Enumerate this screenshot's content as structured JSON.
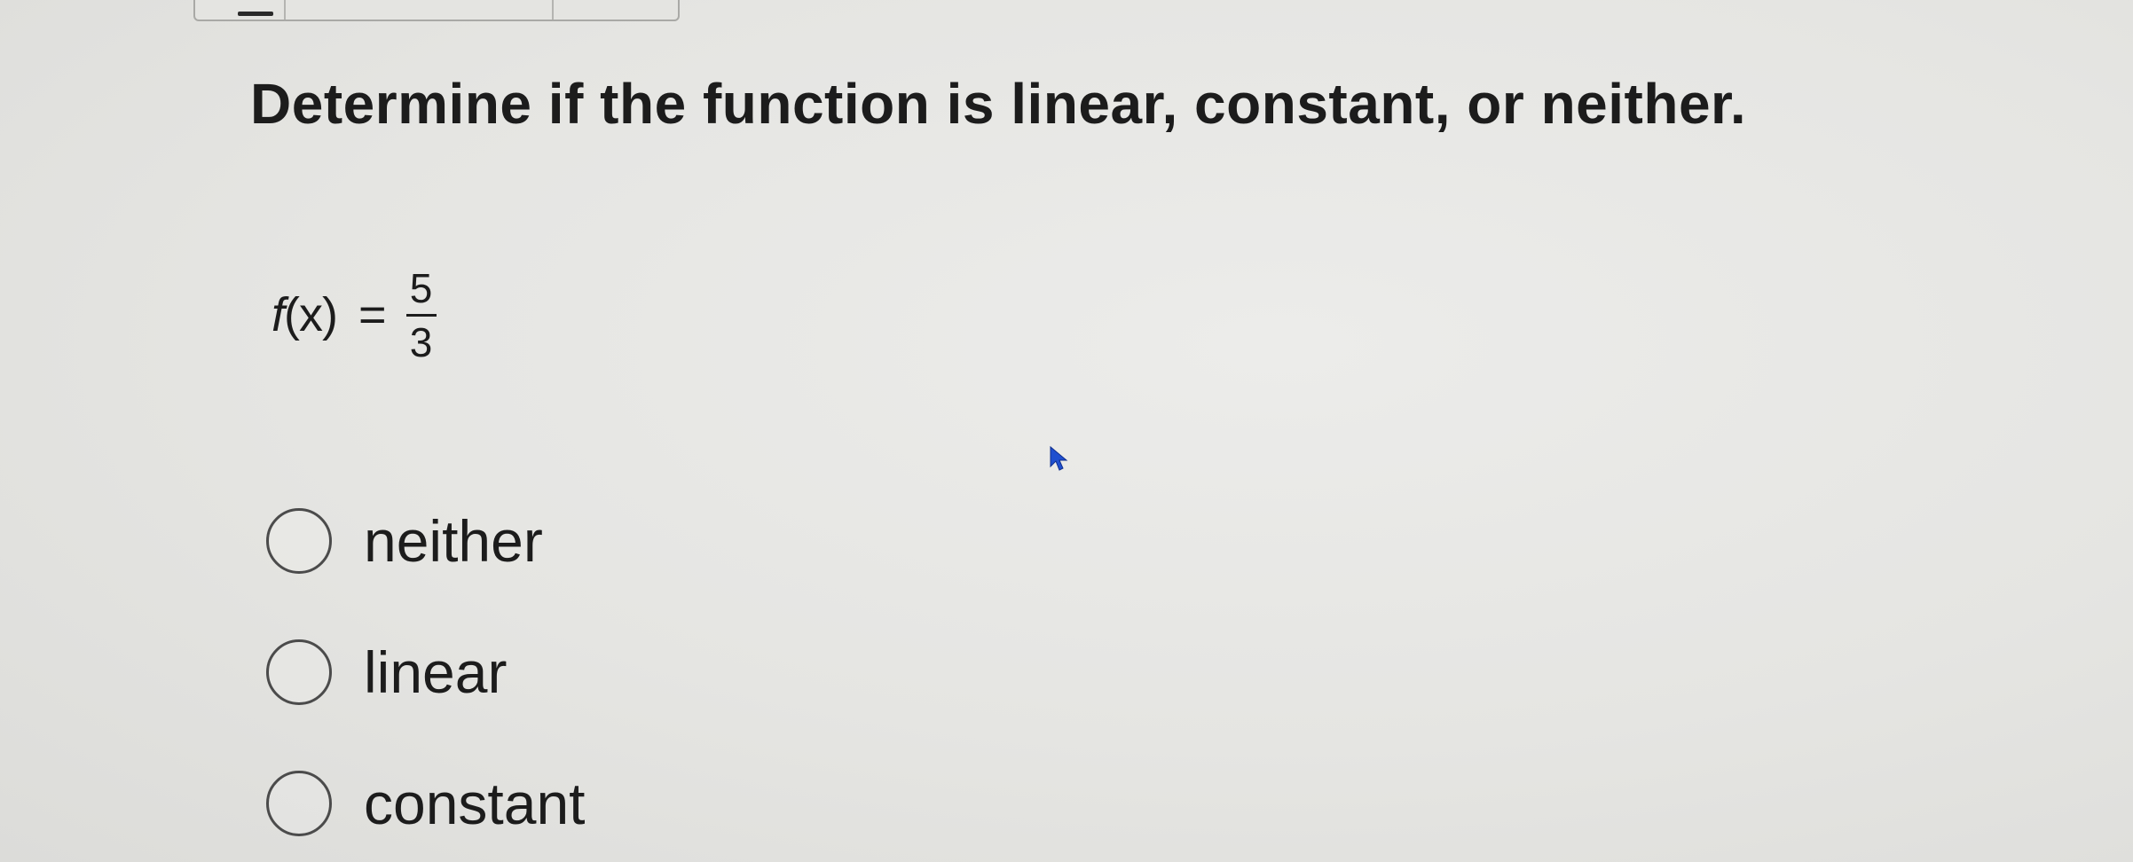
{
  "question": {
    "prompt": "Determine if the function is linear, constant, or neither."
  },
  "equation": {
    "lhs_func": "f",
    "lhs_arg": "(x)",
    "sign": "=",
    "numerator": "5",
    "denominator": "3"
  },
  "options": [
    {
      "label": "neither",
      "selected": false
    },
    {
      "label": "linear",
      "selected": false
    },
    {
      "label": "constant",
      "selected": false
    }
  ],
  "colors": {
    "background": "#e6e6e3",
    "text": "#1c1c1c",
    "radio_border": "#4b4b4b",
    "cursor": "#1f4fcf"
  },
  "icons": {
    "cursor": "mouse-pointer-icon"
  }
}
